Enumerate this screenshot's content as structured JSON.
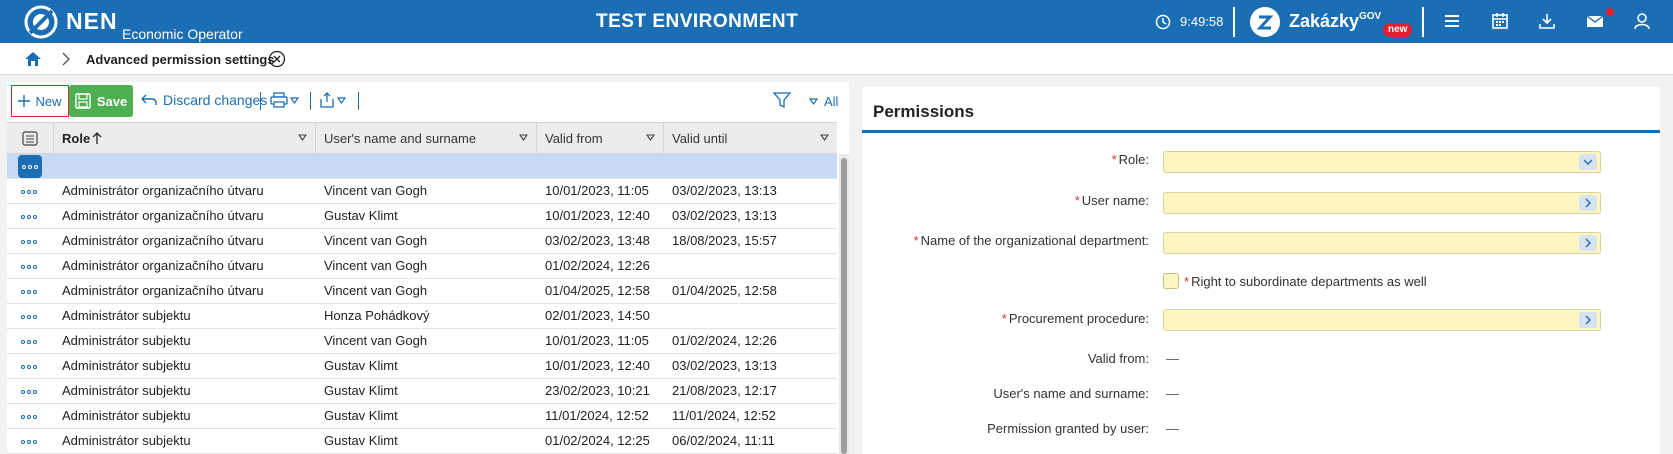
{
  "header": {
    "logo_text": "NEN",
    "logo_sub": "Economic Operator",
    "environment": "TEST ENVIRONMENT",
    "clock": "9:49:58",
    "zakazky": "Zakázky",
    "zakazky_gov": "GOV",
    "zakazky_badge": "new",
    "icons": [
      "menu-icon",
      "calendar-icon",
      "download-icon",
      "mail-icon",
      "user-icon"
    ],
    "accent_color": "#1b6eb4"
  },
  "breadcrumb": {
    "title": "Advanced permission settings"
  },
  "toolbar": {
    "new_label": "New",
    "save_label": "Save",
    "discard_label": "Discard changes",
    "filter_label": "All"
  },
  "grid": {
    "columns": [
      "Role",
      "User's name and surname",
      "Valid from",
      "Valid until"
    ],
    "rows": [
      {
        "role": "Administrátor organizačního útvaru",
        "user": "Vincent van Gogh",
        "from": "10/01/2023, 11:05",
        "until": "03/02/2023, 13:13"
      },
      {
        "role": "Administrátor organizačního útvaru",
        "user": "Gustav Klimt",
        "from": "10/01/2023, 12:40",
        "until": "03/02/2023, 13:13"
      },
      {
        "role": "Administrátor organizačního útvaru",
        "user": "Vincent van Gogh",
        "from": "03/02/2023, 13:48",
        "until": "18/08/2023, 15:57"
      },
      {
        "role": "Administrátor organizačního útvaru",
        "user": "Vincent van Gogh",
        "from": "01/02/2024, 12:26",
        "until": ""
      },
      {
        "role": "Administrátor organizačního útvaru",
        "user": "Vincent van Gogh",
        "from": "01/04/2025, 12:58",
        "until": "01/04/2025, 12:58"
      },
      {
        "role": "Administrátor subjektu",
        "user": "Honza Pohádkový",
        "from": "02/01/2023, 14:50",
        "until": ""
      },
      {
        "role": "Administrátor subjektu",
        "user": "Vincent van Gogh",
        "from": "10/01/2023, 11:05",
        "until": "01/02/2024, 12:26"
      },
      {
        "role": "Administrátor subjektu",
        "user": "Gustav Klimt",
        "from": "10/01/2023, 12:40",
        "until": "03/02/2023, 13:13"
      },
      {
        "role": "Administrátor subjektu",
        "user": "Gustav Klimt",
        "from": "23/02/2023, 10:21",
        "until": "21/08/2023, 12:17"
      },
      {
        "role": "Administrátor subjektu",
        "user": "Gustav Klimt",
        "from": "11/01/2024, 12:52",
        "until": "11/01/2024, 12:52"
      },
      {
        "role": "Administrátor subjektu",
        "user": "Gustav Klimt",
        "from": "01/02/2024, 12:25",
        "until": "06/02/2024, 11:11"
      }
    ]
  },
  "permissions": {
    "title": "Permissions",
    "role_label": "Role:",
    "user_label": "User name:",
    "dept_label": "Name of the organizational department:",
    "subordinate_label": "Right to subordinate departments as well",
    "procedure_label": "Procurement procedure:",
    "valid_from_label": "Valid from:",
    "user_name_label": "User's name and surname:",
    "granted_by_label": "Permission granted by user:",
    "empty_value": "—"
  }
}
